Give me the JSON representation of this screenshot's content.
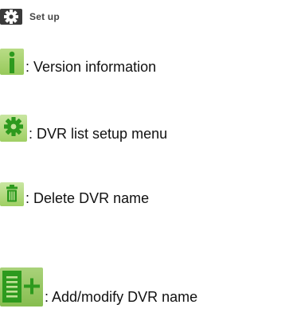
{
  "header": {
    "label": "Set up",
    "icon": "gear-icon"
  },
  "legend": [
    {
      "icon": "info-icon",
      "separator": ":",
      "text": "Version information"
    },
    {
      "icon": "gear-icon",
      "separator": ":",
      "text": "DVR list setup menu"
    },
    {
      "icon": "trash-icon",
      "separator": ":",
      "text": "Delete DVR name"
    },
    {
      "icon": "add-list-icon",
      "separator": ":",
      "text": "Add/modify DVR name"
    }
  ],
  "colors": {
    "icon_green": "#2d9a1e",
    "tile_green": "#a6d36c",
    "header_badge": "#3a3a3a"
  }
}
